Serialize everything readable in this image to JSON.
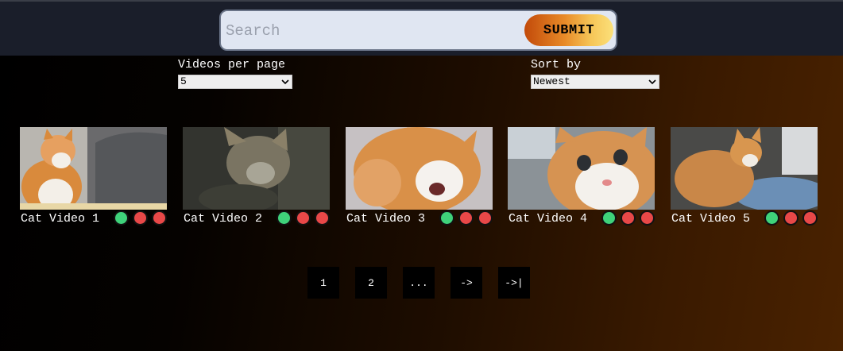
{
  "search": {
    "placeholder": "Search",
    "value": "",
    "submit_label": "SUBMIT"
  },
  "controls": {
    "per_page": {
      "label": "Videos per page",
      "selected": "5"
    },
    "sort": {
      "label": "Sort by",
      "selected": "Newest"
    }
  },
  "videos": [
    {
      "title": "Cat Video 1",
      "thumbnail": "orange-white-cat-with-person-thumbnail"
    },
    {
      "title": "Cat Video 2",
      "thumbnail": "dim-cat-closeup-thumbnail"
    },
    {
      "title": "Cat Video 3",
      "thumbnail": "meowing-cat-thumbnail"
    },
    {
      "title": "Cat Video 4",
      "thumbnail": "cat-face-closeup-thumbnail"
    },
    {
      "title": "Cat Video 5",
      "thumbnail": "cat-on-blanket-thumbnail"
    }
  ],
  "status_dots": [
    "green",
    "red",
    "red"
  ],
  "colors": {
    "topbar": "#1a1e2a",
    "search_bg": "#e0e6f2",
    "submit_gradient_start": "#c24a0a",
    "submit_gradient_end": "#fbe07a",
    "dot_green": "#3fd27a",
    "dot_red": "#e84848",
    "page_button_bg": "#000000"
  },
  "pagination": [
    "1",
    "2",
    "...",
    "->",
    "->|"
  ]
}
